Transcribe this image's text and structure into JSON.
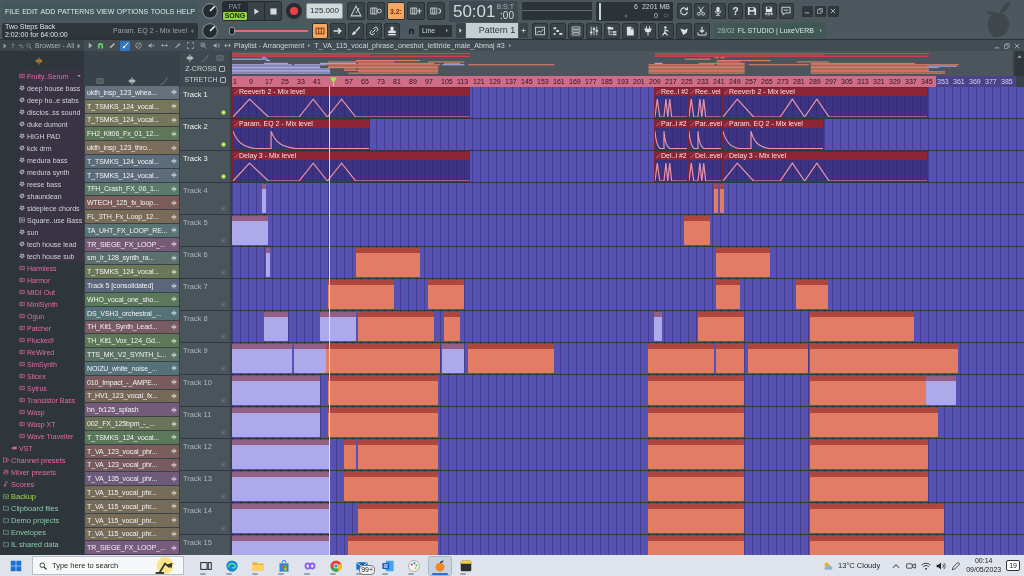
{
  "menu": [
    "FILE",
    "EDIT",
    "ADD",
    "PATTERNS",
    "VIEW",
    "OPTIONS",
    "TOOLS",
    "HELP"
  ],
  "transport": {
    "modes": [
      {
        "label": "PAT",
        "selected": false
      },
      {
        "label": "SONG",
        "selected": true
      }
    ],
    "tempo": "125.000"
  },
  "record_options": [
    {
      "kind": "metronome",
      "on": false
    },
    {
      "kind": "wait",
      "on": false
    },
    {
      "kind": "countdown",
      "text": "3.2:",
      "on": true
    },
    {
      "kind": "blend",
      "on": false
    },
    {
      "kind": "loop",
      "on": false
    }
  ],
  "time": {
    "unit": "B:S:T",
    "value": "50:01",
    "ticks": ":00"
  },
  "cpu": {
    "voices": "6",
    "memory": "2201 MB",
    "polyphony": "0"
  },
  "system_buttons": [
    {
      "kind": "undo"
    },
    {
      "kind": "cut"
    },
    {
      "kind": "mic"
    },
    {
      "kind": "help",
      "text": "?"
    },
    {
      "kind": "save"
    },
    {
      "kind": "save-as"
    },
    {
      "kind": "chat"
    }
  ],
  "hint": {
    "title": "Two Steps Back",
    "detail": "2:02:00 for 64:00:00",
    "target": "Param. EQ 2 - Mix level"
  },
  "slider": {
    "level": 0.12
  },
  "edit_tools": [
    {
      "kind": "snap",
      "on": true
    },
    {
      "kind": "arrow",
      "on": false
    },
    {
      "kind": "brush",
      "on": false
    },
    {
      "kind": "link",
      "on": false
    },
    {
      "kind": "stamp",
      "on": false
    }
  ],
  "snap": {
    "value": "Line"
  },
  "pattern": {
    "name": "Pattern 1"
  },
  "news": {
    "date": "28/02",
    "text": "FL STUDIO | LuxeVERB"
  },
  "browser": {
    "title": "Browser - All",
    "tree": [
      {
        "children": [
          {
            "children": [
              {
                "label": "Fruity..Serum",
                "kind": "plugin",
                "expanded": true,
                "children": [
                  {
                    "label": "deep house bass",
                    "kind": "preset"
                  },
                  {
                    "label": "deep ho..e stabs",
                    "kind": "preset"
                  },
                  {
                    "label": "disclos..ss sound",
                    "kind": "preset"
                  },
                  {
                    "label": "duke dumont",
                    "kind": "preset"
                  },
                  {
                    "label": "HIGH PAD",
                    "kind": "preset"
                  },
                  {
                    "label": "kck drm",
                    "kind": "preset"
                  },
                  {
                    "label": "medura bass",
                    "kind": "preset"
                  },
                  {
                    "label": "medura synth",
                    "kind": "preset"
                  },
                  {
                    "label": "reese bass",
                    "kind": "preset"
                  },
                  {
                    "label": "shaundean",
                    "kind": "preset"
                  },
                  {
                    "label": "sidepiece chords",
                    "kind": "preset"
                  },
                  {
                    "label": "Square..use Bass",
                    "kind": "sample"
                  },
                  {
                    "label": "sun",
                    "kind": "preset"
                  },
                  {
                    "label": "tech house lead",
                    "kind": "preset"
                  },
                  {
                    "label": "tech house sub",
                    "kind": "preset"
                  }
                ]
              },
              {
                "label": "Harmless",
                "kind": "plugin",
                "expanded": false
              },
              {
                "label": "Harmor",
                "kind": "plugin",
                "expanded": false
              },
              {
                "label": "MIDI Out",
                "kind": "plugin",
                "expanded": false
              },
              {
                "label": "MiniSynth",
                "kind": "plugin",
                "expanded": false
              },
              {
                "label": "Ogun",
                "kind": "plugin",
                "expanded": false
              },
              {
                "label": "Patcher",
                "kind": "plugin",
                "expanded": false
              },
              {
                "label": "Plucked!",
                "kind": "plugin",
                "expanded": false
              },
              {
                "label": "ReWired",
                "kind": "plugin",
                "expanded": false
              },
              {
                "label": "SimSynth",
                "kind": "plugin",
                "expanded": false
              },
              {
                "label": "Slicex",
                "kind": "plugin",
                "expanded": false
              },
              {
                "label": "Sytrus",
                "kind": "plugin",
                "expanded": false
              },
              {
                "label": "Transistor Bass",
                "kind": "plugin",
                "expanded": false
              },
              {
                "label": "Wasp",
                "kind": "plugin",
                "expanded": false
              },
              {
                "label": "Wasp XT",
                "kind": "plugin",
                "expanded": false
              },
              {
                "label": "Wave Traveller",
                "kind": "plugin",
                "expanded": false
              }
            ]
          },
          {
            "label": "VST",
            "kind": "vst"
          }
        ]
      },
      {
        "label": "Channel presets",
        "kind": "channel-presets"
      },
      {
        "label": "Mixer presets",
        "kind": "mixer-presets"
      },
      {
        "label": "Scores",
        "kind": "scores"
      },
      {
        "label": "Backup",
        "kind": "backup"
      },
      {
        "label": "Clipboard files",
        "kind": "folder"
      },
      {
        "label": "Demo projects",
        "kind": "folder"
      },
      {
        "label": "Envelopes",
        "kind": "folder"
      },
      {
        "label": "IL shared data",
        "kind": "folder"
      }
    ]
  },
  "picker": {
    "filters": [
      {
        "kind": "patterns",
        "selected": false
      },
      {
        "kind": "audio",
        "selected": true
      },
      {
        "kind": "automation",
        "selected": false
      }
    ],
    "items": [
      {
        "label": "ukth_insp_123_whea...",
        "color": "#67717d"
      },
      {
        "label": "T_TSMKS_124_vocal...",
        "color": "#76765a"
      },
      {
        "label": "T_TSMKS_124_vocal...",
        "color": "#76765a"
      },
      {
        "label": "FH2_Kit06_Fx_01_12...",
        "color": "#5d7758"
      },
      {
        "label": "ukth_insp_123_thro...",
        "color": "#7b6c5c"
      },
      {
        "label": "T_TSMKS_124_vocal...",
        "color": "#5c6c7a"
      },
      {
        "label": "T_TSMKS_124_vocal...",
        "color": "#5c6c7a"
      },
      {
        "label": "TFH_Crash_FX_06_1...",
        "color": "#5c7a6a"
      },
      {
        "label": "WTECH_125_fx_loop...",
        "color": "#7b5c58"
      },
      {
        "label": "FL_3TH_Fx_Loop_12...",
        "color": "#7a6a58"
      },
      {
        "label": "TA_UHT_FX_LOOP_RE...",
        "color": "#5b7275"
      },
      {
        "label": "TR_SIEGE_FX_LOOP_...",
        "color": "#775b76"
      },
      {
        "label": "sm_ir_128_synth_ra...",
        "color": "#5c706e"
      },
      {
        "label": "T_TSMKS_124_vocal...",
        "color": "#6a7858"
      },
      {
        "label": "Track 5 [consolidated]",
        "color": "#5c667a"
      },
      {
        "label": "WHO_vocal_one_sho...",
        "color": "#5c785a"
      },
      {
        "label": "DS_VSH3_orchestral_...",
        "color": "#557276"
      },
      {
        "label": "TH_Kit1_Synth_Lead...",
        "color": "#7a5b63"
      },
      {
        "label": "TH_Kit1_Vox_124_Gd...",
        "color": "#5c7857"
      },
      {
        "label": "TTS_MK_V2_SYNTH_L...",
        "color": "#5c7264"
      },
      {
        "label": "NOIZU_white_noise_...",
        "color": "#557278"
      },
      {
        "label": "010_Impact_-_AMPE...",
        "color": "#7a5b5d"
      },
      {
        "label": "T_HV1_123_vocal_fx...",
        "color": "#786858"
      },
      {
        "label": "hn_fx125_splash",
        "color": "#745b7a"
      },
      {
        "label": "002_FX_125bpm_-_...",
        "color": "#6c7258"
      },
      {
        "label": "T_TSMKS_124_vocal...",
        "color": "#5c785b"
      },
      {
        "label": "T_VA_123_vocal_phr...",
        "color": "#7a5d5b"
      },
      {
        "label": "T_VA_123_vocal_phr...",
        "color": "#785b5f"
      },
      {
        "label": "T_VA_135_vocal_phr...",
        "color": "#6e5b7a"
      },
      {
        "label": "T_VA_115_vocal_phr...",
        "color": "#766c58"
      },
      {
        "label": "T_VA_115_vocal_phr...",
        "color": "#766c58"
      },
      {
        "label": "T_VA_115_vocal_phr...",
        "color": "#766c58"
      },
      {
        "label": "T_VA_115_vocal_phr...",
        "color": "#766c58"
      },
      {
        "label": "TR_SIEGE_FX_LOOP_...",
        "color": "#785b7e"
      }
    ]
  },
  "playlist": {
    "title": "Playlist - Arrangement",
    "clip": "T_VA_115_vocal_phrase_oneshot_letitride_male_Abmaj #3",
    "tools": [
      {
        "kind": "pencil",
        "selected": false
      },
      {
        "kind": "brush",
        "selected": true
      },
      {
        "kind": "delete",
        "selected": false
      },
      {
        "kind": "mute",
        "selected": false
      },
      {
        "kind": "slip",
        "selected": false
      },
      {
        "kind": "slice",
        "selected": false
      },
      {
        "kind": "select",
        "selected": false
      },
      {
        "kind": "zoom",
        "selected": false
      },
      {
        "kind": "playback",
        "selected": false
      }
    ],
    "options": [
      {
        "label": "Z-CROSS",
        "checked": false
      },
      {
        "label": "STRETCH",
        "checked": false
      }
    ],
    "ruler": [
      {
        "kind": "bar",
        "label": "1",
        "selected": true
      },
      {
        "kind": "bar",
        "label": "9",
        "selected": true
      },
      {
        "kind": "bar",
        "label": "17",
        "selected": true
      },
      {
        "kind": "bar",
        "label": "25",
        "selected": true
      },
      {
        "kind": "bar",
        "label": "33",
        "selected": true
      },
      {
        "kind": "bar",
        "label": "41",
        "selected": true
      },
      {
        "kind": "marker",
        "selected": true
      },
      {
        "kind": "bar",
        "label": "57",
        "selected": true
      },
      {
        "kind": "bar",
        "label": "65",
        "selected": true
      },
      {
        "kind": "bar",
        "label": "73",
        "selected": true
      },
      {
        "kind": "bar",
        "label": "81",
        "selected": true
      },
      {
        "kind": "bar",
        "label": "89",
        "selected": true
      },
      {
        "kind": "bar",
        "label": "97",
        "selected": true
      },
      {
        "kind": "bar",
        "label": "105",
        "selected": true
      },
      {
        "kind": "bar",
        "label": "113",
        "selected": true
      },
      {
        "kind": "bar",
        "label": "121",
        "selected": true
      },
      {
        "kind": "bar",
        "label": "129",
        "selected": true
      },
      {
        "kind": "bar",
        "label": "137",
        "selected": true
      },
      {
        "kind": "bar",
        "label": "145",
        "selected": true
      },
      {
        "kind": "bar",
        "label": "153",
        "selected": true
      },
      {
        "kind": "bar",
        "label": "161",
        "selected": true
      },
      {
        "kind": "bar",
        "label": "169",
        "selected": true
      },
      {
        "kind": "bar",
        "label": "177",
        "selected": true
      },
      {
        "kind": "bar",
        "label": "185",
        "selected": true
      },
      {
        "kind": "bar",
        "label": "193",
        "selected": true
      },
      {
        "kind": "bar",
        "label": "201",
        "selected": true
      },
      {
        "kind": "bar",
        "label": "209",
        "selected": true
      },
      {
        "kind": "bar",
        "label": "217",
        "selected": true
      },
      {
        "kind": "bar",
        "label": "225",
        "selected": true
      },
      {
        "kind": "bar",
        "label": "233",
        "selected": true
      },
      {
        "kind": "bar",
        "label": "241",
        "selected": true
      },
      {
        "kind": "bar",
        "label": "249",
        "selected": true
      },
      {
        "kind": "bar",
        "label": "257",
        "selected": true
      },
      {
        "kind": "bar",
        "label": "265",
        "selected": true
      },
      {
        "kind": "bar",
        "label": "273",
        "selected": true
      },
      {
        "kind": "bar",
        "label": "281",
        "selected": true
      },
      {
        "kind": "bar",
        "label": "289",
        "selected": true
      },
      {
        "kind": "bar",
        "label": "297",
        "selected": true
      },
      {
        "kind": "bar",
        "label": "305",
        "selected": true
      },
      {
        "kind": "bar",
        "label": "313",
        "selected": true
      },
      {
        "kind": "bar",
        "label": "321",
        "selected": true
      },
      {
        "kind": "bar",
        "label": "329",
        "selected": true
      },
      {
        "kind": "bar",
        "label": "337",
        "selected": true
      },
      {
        "kind": "bar",
        "label": "345",
        "selected": true
      },
      {
        "kind": "bar",
        "label": "353",
        "selected": false
      },
      {
        "kind": "bar",
        "label": "361",
        "selected": false
      },
      {
        "kind": "bar",
        "label": "369",
        "selected": false
      },
      {
        "kind": "bar",
        "label": "377",
        "selected": false
      },
      {
        "kind": "bar",
        "label": "385",
        "selected": false
      }
    ],
    "tracks": [
      {
        "label": "Track 1",
        "active": true,
        "clips": [
          {
            "kind": "automation",
            "label": "Reeverb 2 - Mix level",
            "decay": false
          },
          {
            "kind": "automation",
            "label": "Ree..l #2",
            "decay": false
          },
          {
            "kind": "automation",
            "label": "Ree..vel",
            "decay": false
          },
          {
            "kind": "automation",
            "label": "Reeverb 2 - Mix level",
            "decay": false
          }
        ]
      },
      {
        "label": "Track 2",
        "active": true,
        "clips": [
          {
            "kind": "automation",
            "label": "Param. EQ 2 - Mix level",
            "decay": true
          },
          {
            "kind": "automation",
            "label": "Par..l #2",
            "decay": true
          },
          {
            "kind": "automation",
            "label": "Par..evel",
            "decay": true
          },
          {
            "kind": "automation",
            "label": "Param. EQ 2 - Mix level",
            "decay": true
          }
        ]
      },
      {
        "label": "Track 3",
        "active": true,
        "clips": [
          {
            "kind": "automation",
            "label": "Delay 3 - Mix level",
            "decay": false
          },
          {
            "kind": "automation",
            "label": "Del..l #2",
            "decay": false
          },
          {
            "kind": "automation",
            "label": "Del..evel",
            "decay": false
          },
          {
            "kind": "automation",
            "label": "Delay 3 - Mix level",
            "decay": false
          }
        ]
      },
      {
        "label": "Track 4",
        "active": false,
        "clips": [
          {
            "kind": "audio",
            "color": "#aeaaea"
          },
          {
            "kind": "audio",
            "color": "#e27c65"
          },
          {
            "kind": "audio",
            "color": "#e27c65"
          }
        ]
      },
      {
        "label": "Track 5",
        "active": false,
        "clips": [
          {
            "kind": "audio",
            "color": "#aeaaea"
          },
          {
            "kind": "audio",
            "color": "#e27c65"
          }
        ]
      },
      {
        "label": "Track 6",
        "active": false,
        "clips": [
          {
            "kind": "audio",
            "color": "#aeaaea"
          },
          {
            "kind": "audio",
            "color": "#e27c65"
          },
          {
            "kind": "audio",
            "color": "#e27c65"
          }
        ]
      },
      {
        "label": "Track 7",
        "active": false,
        "clips": [
          {
            "kind": "audio",
            "color": "#e27c65"
          },
          {
            "kind": "audio",
            "color": "#e27c65"
          },
          {
            "kind": "audio",
            "color": "#e27c65"
          },
          {
            "kind": "audio",
            "color": "#e27c65"
          }
        ]
      },
      {
        "label": "Track 8",
        "active": false,
        "clips": [
          {
            "kind": "audio",
            "color": "#aeaaea"
          },
          {
            "kind": "audio",
            "color": "#aeaaea"
          },
          {
            "kind": "audio",
            "color": "#e27c65"
          },
          {
            "kind": "audio",
            "color": "#e27c65"
          },
          {
            "kind": "audio",
            "color": "#aeaaea"
          },
          {
            "kind": "audio",
            "color": "#e27c65"
          },
          {
            "kind": "audio",
            "color": "#e27c65"
          }
        ]
      },
      {
        "label": "Track 9",
        "active": false,
        "clips": [
          {
            "kind": "audio",
            "color": "#aeaaea"
          },
          {
            "kind": "audio",
            "color": "#aeaaea"
          },
          {
            "kind": "audio",
            "color": "#e27c65"
          },
          {
            "kind": "audio",
            "color": "#aeaaea"
          },
          {
            "kind": "audio",
            "color": "#e27c65"
          },
          {
            "kind": "audio",
            "color": "#e27c65"
          },
          {
            "kind": "audio",
            "color": "#e27c65"
          },
          {
            "kind": "audio",
            "color": "#e27c65"
          },
          {
            "kind": "audio",
            "color": "#e27c65"
          }
        ]
      },
      {
        "label": "Track 10",
        "active": false,
        "clips": [
          {
            "kind": "audio",
            "color": "#aeaaea"
          },
          {
            "kind": "audio",
            "color": "#e27c65"
          },
          {
            "kind": "audio",
            "color": "#e27c65"
          },
          {
            "kind": "audio",
            "color": "#e27c65"
          },
          {
            "kind": "audio",
            "color": "#aeaaea"
          }
        ]
      },
      {
        "label": "Track 11",
        "active": false,
        "clips": [
          {
            "kind": "audio",
            "color": "#aeaaea"
          },
          {
            "kind": "audio",
            "color": "#e27c65"
          },
          {
            "kind": "audio",
            "color": "#e27c65"
          },
          {
            "kind": "audio",
            "color": "#e27c65"
          }
        ]
      },
      {
        "label": "Track 12",
        "active": false,
        "clips": [
          {
            "kind": "audio",
            "color": "#aeaaea"
          },
          {
            "kind": "audio",
            "color": "#e27c65"
          },
          {
            "kind": "audio",
            "color": "#e27c65"
          },
          {
            "kind": "audio",
            "color": "#e27c65"
          },
          {
            "kind": "audio",
            "color": "#e27c65"
          }
        ]
      },
      {
        "label": "Track 13",
        "active": false,
        "clips": [
          {
            "kind": "audio",
            "color": "#aeaaea"
          },
          {
            "kind": "audio",
            "color": "#e27c65"
          },
          {
            "kind": "audio",
            "color": "#e27c65"
          },
          {
            "kind": "audio",
            "color": "#e27c65"
          }
        ]
      },
      {
        "label": "Track 14",
        "active": false,
        "clips": [
          {
            "kind": "audio",
            "color": "#aeaaea"
          },
          {
            "kind": "audio",
            "color": "#e27c65"
          },
          {
            "kind": "audio",
            "color": "#e27c65"
          },
          {
            "kind": "audio",
            "color": "#e27c65"
          }
        ]
      },
      {
        "label": "Track 15",
        "active": false,
        "clips": [
          {
            "kind": "audio",
            "color": "#aeaaea"
          },
          {
            "kind": "audio",
            "color": "#e27c65"
          },
          {
            "kind": "audio",
            "color": "#e27c65"
          },
          {
            "kind": "audio",
            "color": "#e27c65"
          }
        ]
      }
    ]
  },
  "taskbar": {
    "search": {
      "placeholder": "Type here to search"
    },
    "apps": [
      {
        "kind": "task-view",
        "active": false
      },
      {
        "kind": "swirl",
        "active": false
      },
      {
        "kind": "folder",
        "active": false
      },
      {
        "kind": "bag",
        "active": false
      },
      {
        "kind": "loop",
        "active": false
      },
      {
        "kind": "circle",
        "active": false
      },
      {
        "kind": "mail",
        "active": false,
        "badge": "99+"
      },
      {
        "kind": "doc",
        "active": false
      },
      {
        "kind": "palette",
        "active": false
      },
      {
        "kind": "fruit",
        "active": true
      },
      {
        "kind": "note",
        "active": false
      }
    ],
    "weather": "13°C Cloudy",
    "time": "00:14",
    "date": "09/05/2023",
    "notifications": "19"
  }
}
